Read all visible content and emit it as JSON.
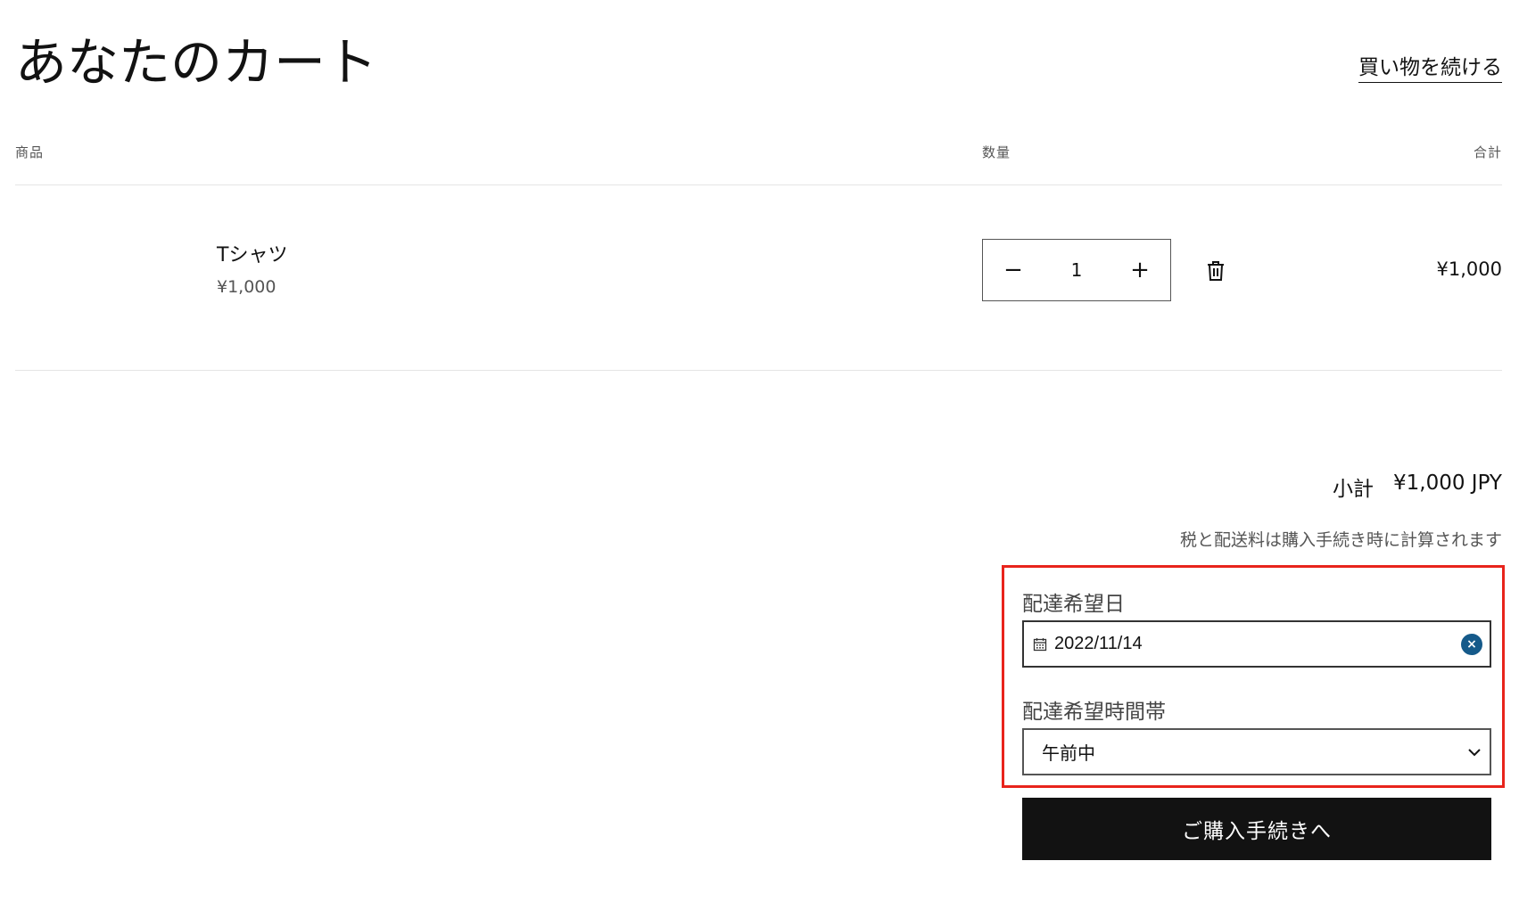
{
  "header": {
    "title": "あなたのカート",
    "continue_shopping": "買い物を続ける"
  },
  "table": {
    "headers": {
      "product": "商品",
      "quantity": "数量",
      "total": "合計"
    },
    "items": [
      {
        "name": "Tシャツ",
        "price": "¥1,000",
        "quantity": "1",
        "line_total": "¥1,000"
      }
    ]
  },
  "quantity_controls": {
    "decrease": "−",
    "increase": "+"
  },
  "summary": {
    "subtotal_label": "小計",
    "subtotal_value": "¥1,000 JPY",
    "tax_note": "税と配送料は購入手続き時に計算されます"
  },
  "delivery": {
    "date_label": "配達希望日",
    "date_value": "2022/11/14",
    "clear_glyph": "×",
    "time_label": "配達希望時間帯",
    "time_value": "午前中"
  },
  "checkout": {
    "label": "ご購入手続きへ"
  },
  "colors": {
    "highlight": "#e8241c",
    "button_bg": "#121212",
    "clear_icon": "#155a8a"
  },
  "icons": {
    "delete": "trash-icon",
    "date": "calendar-icon",
    "clear": "clear-icon",
    "dropdown": "chevron-down-icon"
  }
}
